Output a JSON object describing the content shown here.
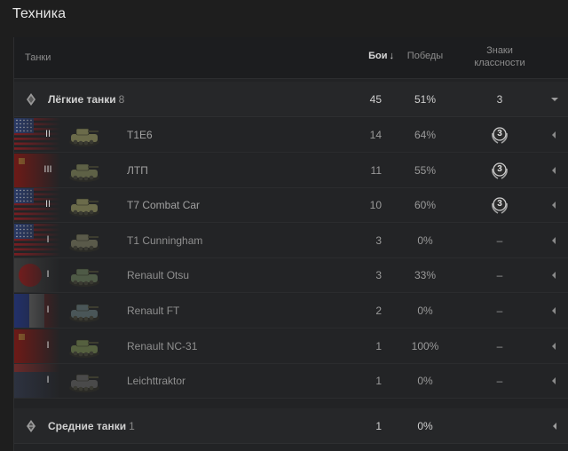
{
  "page": {
    "title": "Техника"
  },
  "table": {
    "headers": {
      "tanks": "Танки",
      "battles": "Бои",
      "sort_arrow": "↓",
      "wins": "Победы",
      "class_line1": "Знаки",
      "class_line2": "классности"
    }
  },
  "groups": [
    {
      "label": "Лёгкие танки",
      "count": "8",
      "battles": "45",
      "wins": "51%",
      "class_marks": "3"
    },
    {
      "label": "Средние танки",
      "count": "1",
      "battles": "1",
      "wins": "0%",
      "class_marks": ""
    }
  ],
  "tanks": [
    {
      "tier": "II",
      "name": "T1E6",
      "battles": "14",
      "wins": "64%",
      "class_mark": "3",
      "nation": "usa",
      "tank_icon": "light-tank-icon"
    },
    {
      "tier": "III",
      "name": "ЛТП",
      "battles": "11",
      "wins": "55%",
      "class_mark": "3",
      "nation": "ussr",
      "tank_icon": "light-tank-icon"
    },
    {
      "tier": "II",
      "name": "T7 Combat Car",
      "battles": "10",
      "wins": "60%",
      "class_mark": "3",
      "nation": "usa",
      "tank_icon": "light-tank-icon"
    },
    {
      "tier": "I",
      "name": "T1 Cunningham",
      "battles": "3",
      "wins": "0%",
      "class_mark": "–",
      "nation": "usa",
      "tank_icon": "light-tank-icon"
    },
    {
      "tier": "I",
      "name": "Renault Otsu",
      "battles": "3",
      "wins": "33%",
      "class_mark": "–",
      "nation": "japan",
      "tank_icon": "light-tank-icon"
    },
    {
      "tier": "I",
      "name": "Renault FT",
      "battles": "2",
      "wins": "0%",
      "class_mark": "–",
      "nation": "france",
      "tank_icon": "light-tank-icon"
    },
    {
      "tier": "I",
      "name": "Renault NC-31",
      "battles": "1",
      "wins": "100%",
      "class_mark": "–",
      "nation": "ussr",
      "tank_icon": "light-tank-icon"
    },
    {
      "tier": "I",
      "name": "Leichttraktor",
      "battles": "1",
      "wins": "0%",
      "class_mark": "–",
      "nation": "germany",
      "tank_icon": "light-tank-icon"
    }
  ],
  "colors": {
    "background": "#1e1e1e",
    "panel": "#222325",
    "header_text": "#e6e6e6"
  }
}
